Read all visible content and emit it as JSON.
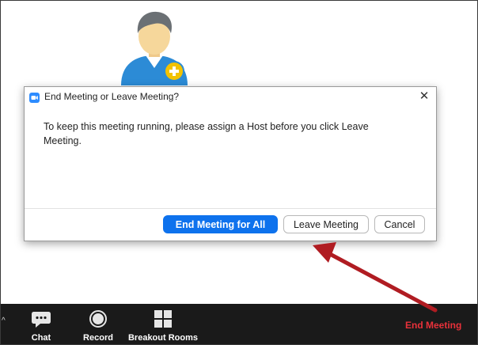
{
  "dialog": {
    "title": "End Meeting or Leave Meeting?",
    "message": "To keep this meeting running, please assign a Host before you click Leave Meeting.",
    "buttons": {
      "end_all": "End Meeting for All",
      "leave": "Leave Meeting",
      "cancel": "Cancel"
    },
    "close_icon": "close-icon"
  },
  "toolbar": {
    "items": [
      {
        "label": "Chat",
        "icon": "chat-icon"
      },
      {
        "label": "Record",
        "icon": "record-icon"
      },
      {
        "label": "Breakout Rooms",
        "icon": "breakout-rooms-icon"
      }
    ],
    "end_meeting": "End Meeting"
  },
  "colors": {
    "primary_button": "#0e72ed",
    "end_meeting_text": "#e8313a",
    "toolbar_bg": "#1a1a1a",
    "arrow": "#b01c22"
  }
}
